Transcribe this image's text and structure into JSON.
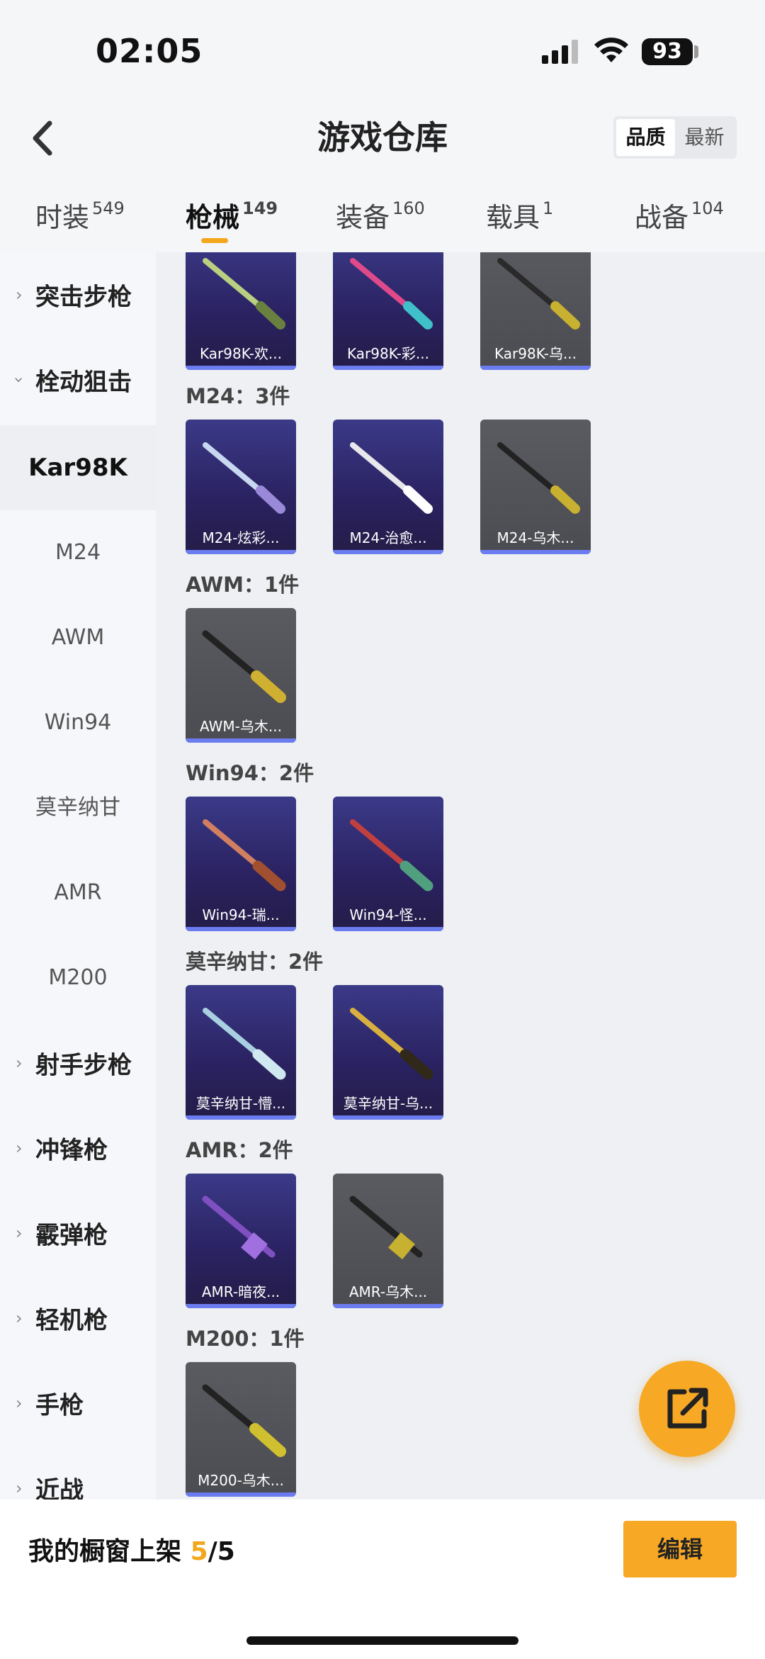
{
  "status": {
    "time": "02:05",
    "battery": "93"
  },
  "header": {
    "title": "游戏仓库",
    "sort_options": [
      "品质",
      "最新"
    ]
  },
  "tabs": [
    {
      "label": "时装",
      "count": "549"
    },
    {
      "label": "枪械",
      "count": "149"
    },
    {
      "label": "装备",
      "count": "160"
    },
    {
      "label": "载具",
      "count": "1"
    },
    {
      "label": "战备",
      "count": "104"
    }
  ],
  "sidebar": {
    "categories": [
      "突击步枪",
      "栓动狙击",
      "射手步枪",
      "冲锋枪",
      "霰弹枪",
      "轻机枪",
      "手枪",
      "近战"
    ],
    "subs": [
      "Kar98K",
      "M24",
      "AWM",
      "Win94",
      "莫辛纳甘",
      "AMR",
      "M200"
    ]
  },
  "groups": {
    "m24": "M24：3件",
    "awm": "AWM：1件",
    "win94": "Win94：2件",
    "mosin": "莫辛纳甘：2件",
    "amr": "AMR：2件",
    "m200": "M200：1件"
  },
  "items": {
    "kar98k": [
      "Kar98K-欢...",
      "Kar98K-彩...",
      "Kar98K-乌..."
    ],
    "m24": [
      "M24-炫彩...",
      "M24-治愈...",
      "M24-乌木..."
    ],
    "awm": [
      "AWM-乌木..."
    ],
    "win94": [
      "Win94-瑞...",
      "Win94-怪..."
    ],
    "mosin": [
      "莫辛纳甘-懵...",
      "莫辛纳甘-乌..."
    ],
    "amr": [
      "AMR-暗夜...",
      "AMR-乌木..."
    ],
    "m200": [
      "M200-乌木..."
    ]
  },
  "bottom": {
    "showcase_prefix": "我的橱窗上架",
    "showcase_count": "5",
    "showcase_total": "/5",
    "edit_label": "编辑"
  }
}
